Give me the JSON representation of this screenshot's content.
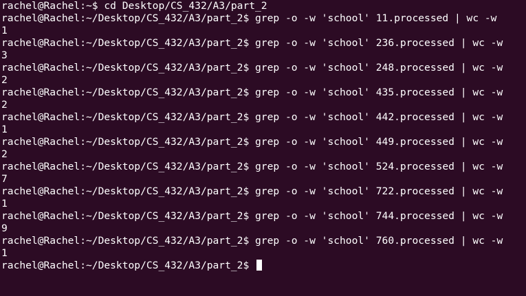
{
  "terminal": {
    "lines": [
      "rachel@Rachel:~$ cd Desktop/CS_432/A3/part_2",
      "rachel@Rachel:~/Desktop/CS_432/A3/part_2$ grep -o -w 'school' 11.processed | wc -w",
      "1",
      "rachel@Rachel:~/Desktop/CS_432/A3/part_2$ grep -o -w 'school' 236.processed | wc -w",
      "3",
      "rachel@Rachel:~/Desktop/CS_432/A3/part_2$ grep -o -w 'school' 248.processed | wc -w",
      "2",
      "rachel@Rachel:~/Desktop/CS_432/A3/part_2$ grep -o -w 'school' 435.processed | wc -w",
      "2",
      "rachel@Rachel:~/Desktop/CS_432/A3/part_2$ grep -o -w 'school' 442.processed | wc -w",
      "1",
      "rachel@Rachel:~/Desktop/CS_432/A3/part_2$ grep -o -w 'school' 449.processed | wc -w",
      "2",
      "rachel@Rachel:~/Desktop/CS_432/A3/part_2$ grep -o -w 'school' 524.processed | wc -w",
      "7",
      "rachel@Rachel:~/Desktop/CS_432/A3/part_2$ grep -o -w 'school' 722.processed | wc -w",
      "1",
      "rachel@Rachel:~/Desktop/CS_432/A3/part_2$ grep -o -w 'school' 744.processed | wc -w",
      "9",
      "rachel@Rachel:~/Desktop/CS_432/A3/part_2$ grep -o -w 'school' 760.processed | wc -w",
      "1"
    ],
    "prompt": "rachel@Rachel:~/Desktop/CS_432/A3/part_2$ "
  },
  "colors": {
    "background": "#2c0b24",
    "text": "#ffffff"
  }
}
